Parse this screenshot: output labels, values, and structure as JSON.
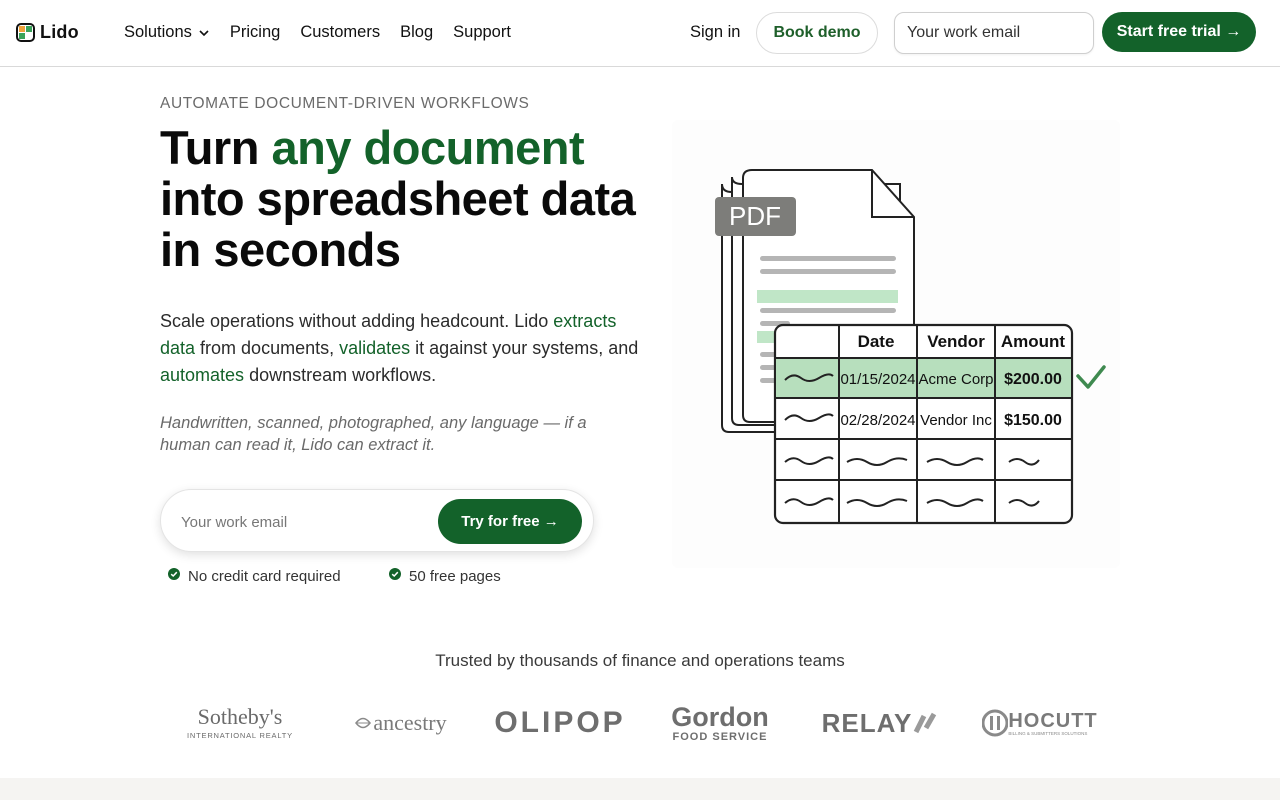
{
  "brand": {
    "name": "Lido"
  },
  "nav": {
    "links": [
      {
        "label": "Solutions",
        "has_dropdown": true
      },
      {
        "label": "Pricing"
      },
      {
        "label": "Customers"
      },
      {
        "label": "Blog"
      },
      {
        "label": "Support"
      }
    ],
    "sign_in": "Sign in",
    "book_demo": "Book demo",
    "email_placeholder": "Your work email",
    "start_trial": "Start free trial →"
  },
  "hero": {
    "eyebrow": "AUTOMATE DOCUMENT-DRIVEN WORKFLOWS",
    "headline_prefix": "Turn ",
    "headline_accent": "any document",
    "headline_rest": " into spreadsheet data in seconds",
    "sub": {
      "part1": "Scale operations without adding headcount. Lido ",
      "link1": "extracts data",
      "part2": " from documents, ",
      "link2": "validates",
      "part3": " it against your systems, and ",
      "link3": "automates",
      "part4": " downstream workflows."
    },
    "note": "Handwritten, scanned, photographed, any language — if a human can read it, Lido can extract it.",
    "email_placeholder": "Your work email",
    "cta": "Try for free →",
    "perks": [
      "No credit card required",
      "50 free pages"
    ]
  },
  "illustration": {
    "doc_label": "PDF",
    "table_headers": [
      "Date",
      "Vendor",
      "Amount"
    ],
    "rows": [
      {
        "date": "01/15/2024",
        "vendor": "Acme Corp",
        "amount": "$200.00",
        "highlighted": true
      },
      {
        "date": "02/28/2024",
        "vendor": "Vendor Inc",
        "amount": "$150.00",
        "highlighted": false
      }
    ]
  },
  "trusted": {
    "label": "Trusted by thousands of finance and operations teams",
    "logos": [
      {
        "name": "sothebys-logo",
        "line1": "Sotheby's",
        "line2": "INTERNATIONAL REALTY"
      },
      {
        "name": "ancestry-logo",
        "line1": "ancestry"
      },
      {
        "name": "olipop-logo",
        "line1": "OLIPOP"
      },
      {
        "name": "gordon-logo",
        "line1": "Gordon",
        "line2": "FOOD SERVICE"
      },
      {
        "name": "relay-logo",
        "line1": "RELAY"
      },
      {
        "name": "hocutt-logo",
        "line1": "HOCUTT",
        "line2": "BILLING & SUBMITTERS SOLUTIONS"
      }
    ]
  },
  "colors": {
    "accent": "#13622a",
    "row_highlight": "#bfe3c4"
  }
}
